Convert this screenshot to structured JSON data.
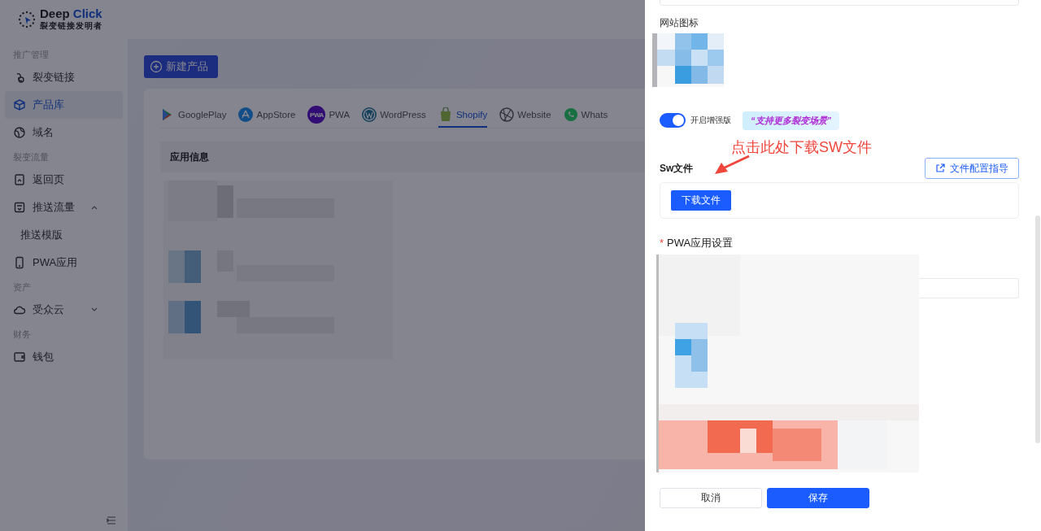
{
  "brand": {
    "name": "Deep",
    "name_accent": "Click",
    "tagline": "裂变链接发明者"
  },
  "sidebar": {
    "sections": [
      {
        "heading": "推广管理",
        "items": [
          {
            "label": "裂变链接",
            "selected": false
          },
          {
            "label": "产品库",
            "selected": true
          },
          {
            "label": "域名",
            "selected": false
          }
        ]
      },
      {
        "heading": "裂变流量",
        "items": [
          {
            "label": "返回页",
            "selected": false
          },
          {
            "label": "推送流量",
            "selected": false,
            "expanded": true,
            "children": [
              {
                "label": "推送模版",
                "selected": false
              }
            ]
          },
          {
            "label": "PWA应用",
            "selected": false
          }
        ]
      },
      {
        "heading": "资产",
        "items": [
          {
            "label": "受众云",
            "selected": false,
            "expanded": false
          }
        ]
      },
      {
        "heading": "财务",
        "items": [
          {
            "label": "钱包",
            "selected": false
          }
        ]
      }
    ]
  },
  "main": {
    "new_button": "新建产品",
    "tabs": [
      {
        "label": "GooglePlay",
        "selected": false
      },
      {
        "label": "AppStore",
        "selected": false
      },
      {
        "label": "PWA",
        "selected": false,
        "icon_text": "PWA"
      },
      {
        "label": "WordPress",
        "selected": false
      },
      {
        "label": "Shopify",
        "selected": true
      },
      {
        "label": "Website",
        "selected": false
      },
      {
        "label": "Whats",
        "selected": false
      }
    ],
    "panel_title": "应用信息"
  },
  "drawer": {
    "site_icon_label": "网站图标",
    "enhanced": {
      "on": true,
      "label": "开启增强版",
      "promo": "“支持更多裂变场景”"
    },
    "annotation": "点击此处下载SW文件",
    "sw_title": "Sw文件",
    "guide_button": "文件配置指导",
    "download_button": "下载文件",
    "pwa_title": "PWA应用设置",
    "required_mark": "*",
    "buttons": [
      {
        "label": "取消",
        "kind": "secondary"
      },
      {
        "label": "保存",
        "kind": "primary"
      }
    ]
  }
}
